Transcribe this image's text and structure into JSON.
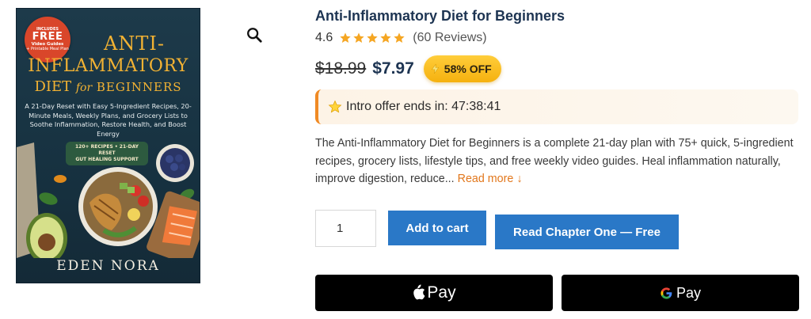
{
  "cover": {
    "badge": {
      "line1": "INCLUDES",
      "line2": "FREE",
      "line3": "Video Guides",
      "line4": "+ Printable Meal Plan"
    },
    "title_line1": "ANTI-",
    "title_line2": "INFLAMMATORY",
    "title_line3a": "DIET",
    "title_line3b": "for",
    "title_line3c": "BEGINNERS",
    "subtitle": "A 21-Day Reset with Easy 5-Ingredient Recipes, 20-Minute Meals, Weekly Plans, and Grocery Lists to Soothe Inflammation, Restore Health, and Boost Energy",
    "pill_line1": "120+ RECIPES • 21-DAY RESET",
    "pill_line2": "GUT HEALING SUPPORT",
    "author": "EDEN NORA"
  },
  "product": {
    "title": "Anti-Inflammatory Diet for Beginners",
    "rating_value": "4.6",
    "rating_stars": 4.6,
    "reviews": "(60 Reviews)",
    "old_price": "$18.99",
    "new_price": "$7.97",
    "discount": "58% OFF",
    "offer_label": "Intro offer ends in:",
    "offer_timer": "47:38:41",
    "description": "The Anti-Inflammatory Diet for Beginners is a complete 21-day plan with 75+ quick, 5-ingredient recipes, grocery lists, lifestyle tips, and free weekly video guides. Heal inflammation naturally, improve digestion, reduce...",
    "read_more": "Read more ↓",
    "quantity": "1",
    "add_to_cart": "Add to cart",
    "read_chapter": "Read Chapter One — Free",
    "apple_pay": "Pay",
    "google_pay": "Pay"
  },
  "colors": {
    "title": "#1d3452",
    "star": "#f5a623",
    "button": "#2a78c7",
    "offer_accent": "#f08a24",
    "badge": "#f5b10f",
    "read_more": "#e2771c"
  },
  "icons": {
    "zoom": "magnifier-icon",
    "bolt": "lightning-icon",
    "offer": "star-icon",
    "apple": "apple-logo-icon",
    "google": "google-g-icon"
  }
}
